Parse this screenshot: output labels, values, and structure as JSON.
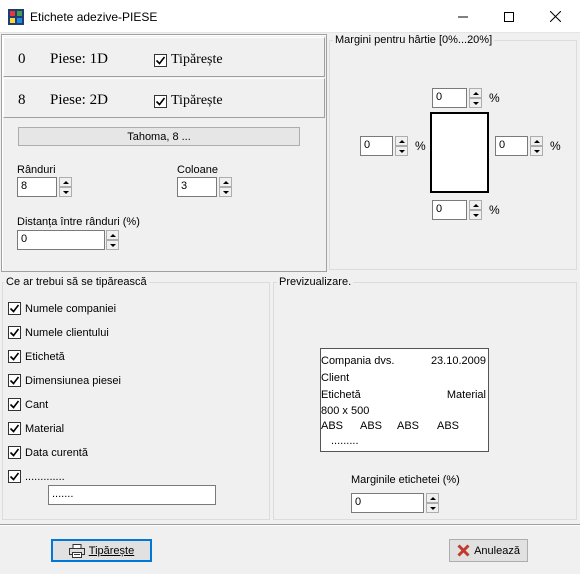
{
  "window": {
    "title": "Etichete adezive-PIESE"
  },
  "rows": [
    {
      "num": "0",
      "label": "Piese: 1D",
      "print_label": "Tipărește"
    },
    {
      "num": "8",
      "label": "Piese: 2D",
      "print_label": "Tipărește"
    }
  ],
  "font_button": "Tahoma, 8 ...",
  "fields": {
    "randuri_label": "Rânduri",
    "randuri_value": "8",
    "coloane_label": "Coloane",
    "coloane_value": "3",
    "distanta_label": "Distanța între rânduri (%)",
    "distanta_value": "0"
  },
  "margins": {
    "group_label": "Margini pentru hârtie [0%...20%]",
    "top": "0",
    "left": "0",
    "right": "0",
    "bottom": "0",
    "unit": "%"
  },
  "print_group": {
    "label": "Ce ar trebui să se tipărească",
    "items": [
      "Numele companiei",
      "Numele clientului",
      "Etichetă",
      "Dimensiunea piesei",
      "Cant",
      "Material",
      "Data curentă",
      "............."
    ],
    "custom_value": "......."
  },
  "preview": {
    "label": "Previzualizare.",
    "company": "Compania dvs.",
    "date": "23.10.2009",
    "client": "Client",
    "label_text": "Etichetă",
    "material": "Material",
    "dims": "800 x 500",
    "abs": [
      "ABS",
      "ABS",
      "ABS",
      "ABS"
    ],
    "dots": ".........",
    "margin_label": "Marginile etichetei (%)",
    "margin_value": "0"
  },
  "buttons": {
    "print": "Tipărește",
    "cancel": "Anulează"
  },
  "colors": {
    "title_bg": "#ffffff",
    "body_bg": "#f0f0f0",
    "cancel_x": "#c0392b"
  }
}
